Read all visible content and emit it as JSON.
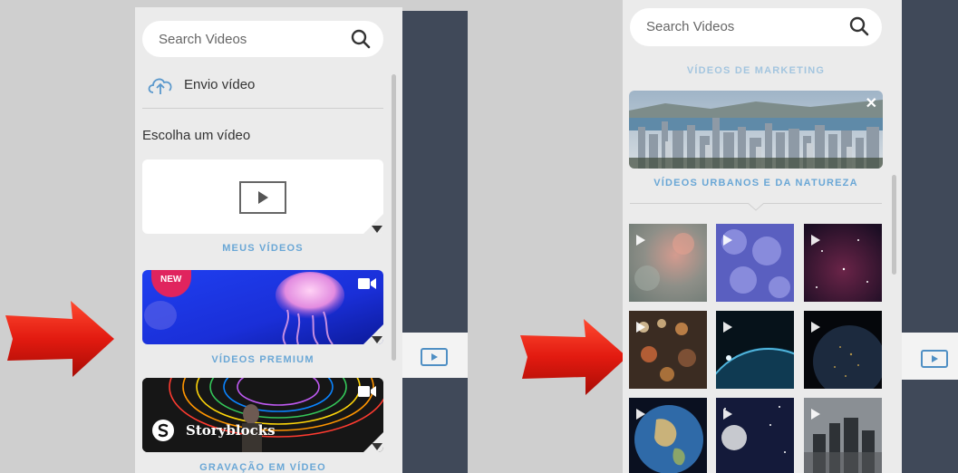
{
  "left": {
    "search_placeholder": "Search Videos",
    "upload_label": "Envio vídeo",
    "choose_label": "Escolha um vídeo",
    "my_videos_caption": "MEUS VÍDEOS",
    "premium_badge": "NEW",
    "premium_caption": "VÍDEOS PREMIUM",
    "storyblocks_brand": "Storyblocks",
    "recording_caption": "GRAVAÇÃO EM VÍDEO"
  },
  "right": {
    "search_placeholder": "Search Videos",
    "marketing_caption": "VÍDEOS DE MARKETING",
    "urban_caption": "VÍDEOS URBANOS E DA NATUREZA",
    "close_symbol": "✕"
  },
  "icons": {
    "search": "magnifier-icon",
    "upload": "cloud-upload-icon",
    "play": "play-icon",
    "camera": "video-camera-icon",
    "arrow": "red-arrow-icon"
  },
  "colors": {
    "accent_blue": "#6aa7d6",
    "dark_bar": "#404959",
    "arrow_red": "#e21a10"
  }
}
